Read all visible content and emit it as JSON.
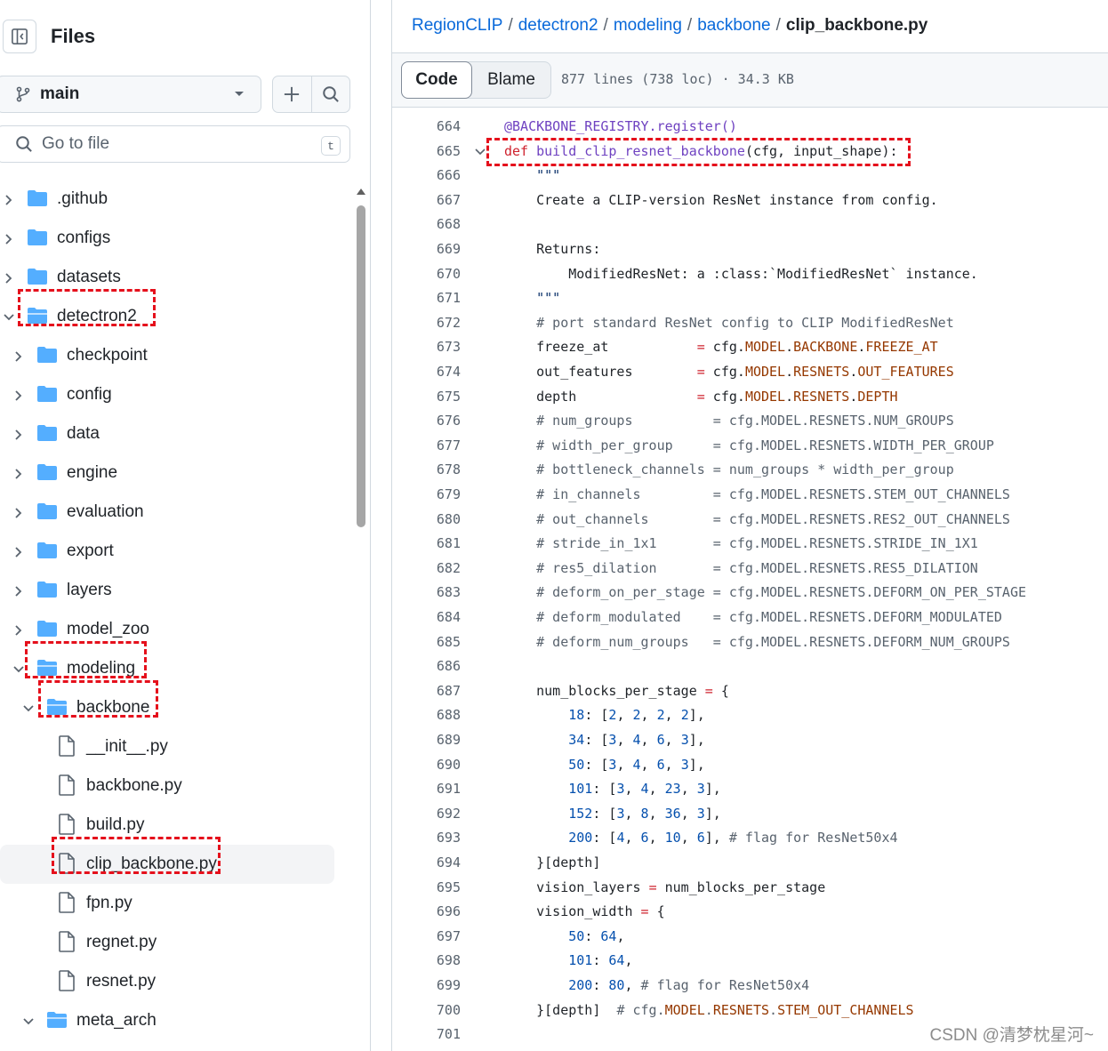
{
  "sidebar": {
    "title": "Files",
    "branch": "main",
    "search_placeholder": "Go to file",
    "search_shortcut": "t",
    "tree": [
      {
        "name": ".github",
        "type": "folder",
        "depth": 0,
        "expanded": false
      },
      {
        "name": "configs",
        "type": "folder",
        "depth": 0,
        "expanded": false
      },
      {
        "name": "datasets",
        "type": "folder",
        "depth": 0,
        "expanded": false
      },
      {
        "name": "detectron2",
        "type": "folder",
        "depth": 0,
        "expanded": true,
        "highlighted": true
      },
      {
        "name": "checkpoint",
        "type": "folder",
        "depth": 1,
        "expanded": false
      },
      {
        "name": "config",
        "type": "folder",
        "depth": 1,
        "expanded": false
      },
      {
        "name": "data",
        "type": "folder",
        "depth": 1,
        "expanded": false
      },
      {
        "name": "engine",
        "type": "folder",
        "depth": 1,
        "expanded": false
      },
      {
        "name": "evaluation",
        "type": "folder",
        "depth": 1,
        "expanded": false
      },
      {
        "name": "export",
        "type": "folder",
        "depth": 1,
        "expanded": false
      },
      {
        "name": "layers",
        "type": "folder",
        "depth": 1,
        "expanded": false
      },
      {
        "name": "model_zoo",
        "type": "folder",
        "depth": 1,
        "expanded": false
      },
      {
        "name": "modeling",
        "type": "folder",
        "depth": 1,
        "expanded": true,
        "highlighted": true
      },
      {
        "name": "backbone",
        "type": "folder",
        "depth": 2,
        "expanded": true,
        "highlighted": true
      },
      {
        "name": "__init__.py",
        "type": "file",
        "depth": 3
      },
      {
        "name": "backbone.py",
        "type": "file",
        "depth": 3
      },
      {
        "name": "build.py",
        "type": "file",
        "depth": 3
      },
      {
        "name": "clip_backbone.py",
        "type": "file",
        "depth": 3,
        "selected": true,
        "highlighted": true
      },
      {
        "name": "fpn.py",
        "type": "file",
        "depth": 3
      },
      {
        "name": "regnet.py",
        "type": "file",
        "depth": 3
      },
      {
        "name": "resnet.py",
        "type": "file",
        "depth": 3
      },
      {
        "name": "meta_arch",
        "type": "folder",
        "depth": 2,
        "expanded": true
      }
    ]
  },
  "breadcrumb": [
    "RegionCLIP",
    "detectron2",
    "modeling",
    "backbone"
  ],
  "breadcrumb_current": "clip_backbone.py",
  "breadcrumb_sep": "/",
  "toolbar": {
    "code_tab": "Code",
    "blame_tab": "Blame",
    "file_info": "877 lines (738 loc) · 34.3 KB"
  },
  "code": [
    {
      "n": "664",
      "t": "@BACKBONE_REGISTRY.register()"
    },
    {
      "n": "665",
      "t": "def build_clip_resnet_backbone(cfg, input_shape):",
      "fold": true,
      "highlighted": true
    },
    {
      "n": "666",
      "t": "    \"\"\""
    },
    {
      "n": "667",
      "t": "    Create a CLIP-version ResNet instance from config."
    },
    {
      "n": "668",
      "t": ""
    },
    {
      "n": "669",
      "t": "    Returns:"
    },
    {
      "n": "670",
      "t": "        ModifiedResNet: a :class:`ModifiedResNet` instance."
    },
    {
      "n": "671",
      "t": "    \"\"\""
    },
    {
      "n": "672",
      "t": "    # port standard ResNet config to CLIP ModifiedResNet"
    },
    {
      "n": "673",
      "t": "    freeze_at           = cfg.MODEL.BACKBONE.FREEZE_AT"
    },
    {
      "n": "674",
      "t": "    out_features        = cfg.MODEL.RESNETS.OUT_FEATURES"
    },
    {
      "n": "675",
      "t": "    depth               = cfg.MODEL.RESNETS.DEPTH"
    },
    {
      "n": "676",
      "t": "    # num_groups          = cfg.MODEL.RESNETS.NUM_GROUPS"
    },
    {
      "n": "677",
      "t": "    # width_per_group     = cfg.MODEL.RESNETS.WIDTH_PER_GROUP"
    },
    {
      "n": "678",
      "t": "    # bottleneck_channels = num_groups * width_per_group"
    },
    {
      "n": "679",
      "t": "    # in_channels         = cfg.MODEL.RESNETS.STEM_OUT_CHANNELS"
    },
    {
      "n": "680",
      "t": "    # out_channels        = cfg.MODEL.RESNETS.RES2_OUT_CHANNELS"
    },
    {
      "n": "681",
      "t": "    # stride_in_1x1       = cfg.MODEL.RESNETS.STRIDE_IN_1X1"
    },
    {
      "n": "682",
      "t": "    # res5_dilation       = cfg.MODEL.RESNETS.RES5_DILATION"
    },
    {
      "n": "683",
      "t": "    # deform_on_per_stage = cfg.MODEL.RESNETS.DEFORM_ON_PER_STAGE"
    },
    {
      "n": "684",
      "t": "    # deform_modulated    = cfg.MODEL.RESNETS.DEFORM_MODULATED"
    },
    {
      "n": "685",
      "t": "    # deform_num_groups   = cfg.MODEL.RESNETS.DEFORM_NUM_GROUPS"
    },
    {
      "n": "686",
      "t": ""
    },
    {
      "n": "687",
      "t": "    num_blocks_per_stage = {"
    },
    {
      "n": "688",
      "t": "        18: [2, 2, 2, 2],"
    },
    {
      "n": "689",
      "t": "        34: [3, 4, 6, 3],"
    },
    {
      "n": "690",
      "t": "        50: [3, 4, 6, 3],"
    },
    {
      "n": "691",
      "t": "        101: [3, 4, 23, 3],"
    },
    {
      "n": "692",
      "t": "        152: [3, 8, 36, 3],"
    },
    {
      "n": "693",
      "t": "        200: [4, 6, 10, 6], # flag for ResNet50x4"
    },
    {
      "n": "694",
      "t": "    }[depth]"
    },
    {
      "n": "695",
      "t": "    vision_layers = num_blocks_per_stage"
    },
    {
      "n": "696",
      "t": "    vision_width = {"
    },
    {
      "n": "697",
      "t": "        50: 64,"
    },
    {
      "n": "698",
      "t": "        101: 64,"
    },
    {
      "n": "699",
      "t": "        200: 80, # flag for ResNet50x4"
    },
    {
      "n": "700",
      "t": "    }[depth]  # cfg.MODEL.RESNETS.STEM_OUT_CHANNELS"
    },
    {
      "n": "701",
      "t": ""
    }
  ],
  "watermark": "CSDN @清梦枕星河~",
  "colors": {
    "link": "#0969da",
    "highlight": "#e5101c",
    "folder": "#54aeff"
  }
}
